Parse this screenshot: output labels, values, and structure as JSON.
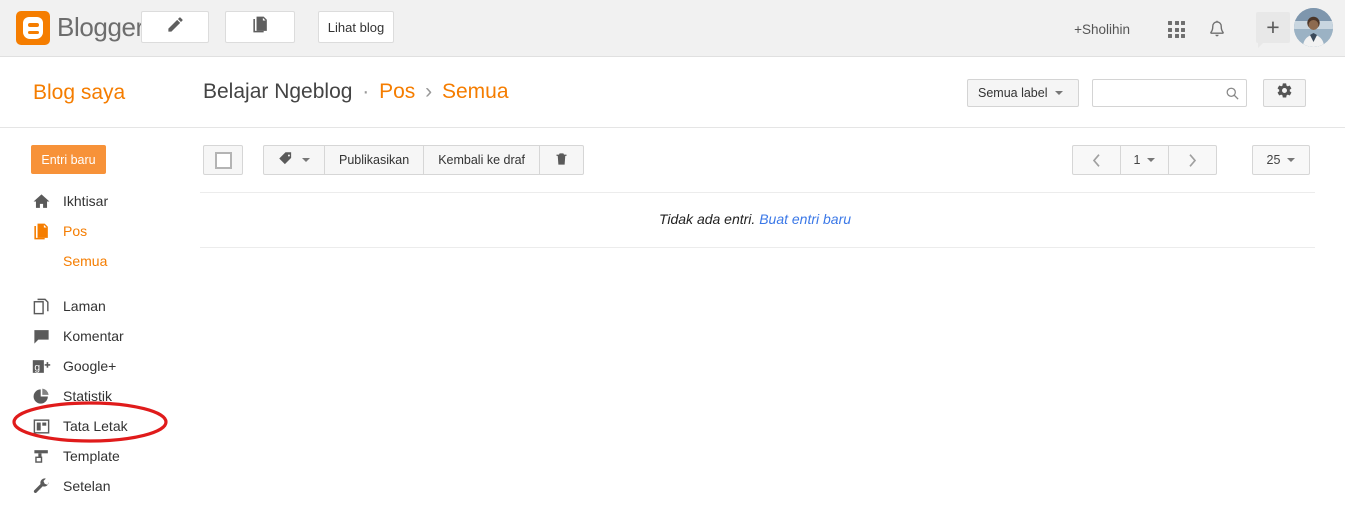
{
  "topbar": {
    "brand": "Blogger",
    "brand_icon": "blogger-logo-icon",
    "new_post_icon": "pencil-icon",
    "posts_icon": "documents-icon",
    "view_blog_label": "Lihat blog",
    "account_name": "+Sholihin",
    "apps_icon": "apps-grid-icon",
    "notifications_icon": "bell-icon",
    "share_label": "+",
    "avatar_icon": "user-avatar"
  },
  "crumbbar": {
    "my_blogs_label": "Blog saya",
    "blog_title": "Belajar Ngeblog",
    "separator_dot": "·",
    "section_label": "Pos",
    "separator_chevron": "›",
    "subsection_label": "Semua",
    "label_filter": "Semua label",
    "search_placeholder": "",
    "search_value": "",
    "search_icon": "search-icon",
    "settings_icon": "gear-icon"
  },
  "sidebar": {
    "new_entry_label": "Entri baru",
    "items": [
      {
        "label": "Ikhtisar",
        "icon": "home-icon",
        "active": false
      },
      {
        "label": "Pos",
        "icon": "posts-icon",
        "active": true
      },
      {
        "label": "Laman",
        "icon": "pages-icon",
        "active": false
      },
      {
        "label": "Komentar",
        "icon": "comment-icon",
        "active": false
      },
      {
        "label": "Google+",
        "icon": "google-plus-icon",
        "active": false
      },
      {
        "label": "Statistik",
        "icon": "pie-chart-icon",
        "active": false
      },
      {
        "label": "Tata Letak",
        "icon": "layout-icon",
        "active": false
      },
      {
        "label": "Template",
        "icon": "template-icon",
        "active": false
      },
      {
        "label": "Setelan",
        "icon": "wrench-icon",
        "active": false
      }
    ],
    "sub_item_label": "Semua"
  },
  "toolbar": {
    "select_all_icon": "checkbox-icon",
    "label_icon": "tag-icon",
    "publish_label": "Publikasikan",
    "revert_draft_label": "Kembali ke draf",
    "delete_icon": "trash-icon",
    "prev_icon": "chevron-left-icon",
    "page_number": "1",
    "next_icon": "chevron-right-icon",
    "per_page": "25"
  },
  "main": {
    "empty_text": "Tidak ada entri.",
    "empty_link": "Buat entri baru"
  },
  "annotation": {
    "shape": "red-ellipse",
    "target": "Tata Letak",
    "color": "#e01b1b"
  },
  "colors": {
    "brand_orange": "#f57d00",
    "button_orange": "#f79239",
    "link_blue": "#3b78e7",
    "header_bg": "#f1f1f1",
    "annotation_red": "#e01b1b"
  }
}
